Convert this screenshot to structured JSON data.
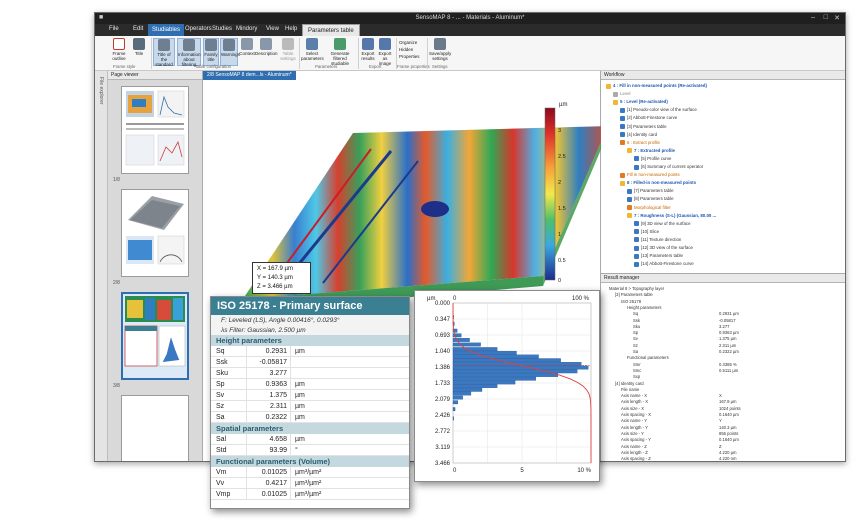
{
  "window": {
    "title": "SensoMAP 8 - ... - Materials - Aluminum*",
    "menus": [
      "File",
      "Edit",
      "Studiables",
      "Operators",
      "Studies",
      "Mindory",
      "View",
      "Help"
    ],
    "context_tab": "Parameters table"
  },
  "ribbon": {
    "buttons": [
      {
        "label": "Frame outline",
        "group": "Frame style"
      },
      {
        "label": "Title",
        "group": "Frame style"
      },
      {
        "label": "Title of the standard",
        "group": "Table configuration"
      },
      {
        "label": "Information about filtering",
        "group": "Table configuration"
      },
      {
        "label": "Family title",
        "group": "Table configuration"
      },
      {
        "label": "Warnings",
        "group": "Table configuration"
      },
      {
        "label": "Context",
        "group": "Table configuration"
      },
      {
        "label": "Description",
        "group": "Table configuration"
      },
      {
        "label": "Table settings",
        "group": "Table configuration"
      },
      {
        "label": "Select parameters",
        "group": "Parameters"
      },
      {
        "label": "Generate filtered studiable",
        "group": "Parameters"
      },
      {
        "label": "Export results",
        "group": "Export"
      },
      {
        "label": "Export as image",
        "group": "Export"
      },
      {
        "label": "Organize",
        "group": "Frame properties"
      },
      {
        "label": "Hidden",
        "group": "Frame properties"
      },
      {
        "label": "Properties",
        "group": "Frame properties"
      },
      {
        "label": "Save/apply settings",
        "group": "Settings"
      }
    ],
    "groups": [
      "Frame style",
      "Table configuration",
      "Parameters",
      "Export",
      "Frame properties",
      "Settings"
    ]
  },
  "left_strip": {
    "label": "File explorer"
  },
  "page_viewer": {
    "title": "Page viewer",
    "pages": [
      "1/8",
      "2/8",
      "3/8",
      "4/8"
    ]
  },
  "document": {
    "tab_label": "2/8 SensoMAP 8 dem...ls - Aluminum*",
    "colorbar": {
      "unit": "µm",
      "ticks": [
        "3",
        "2.5",
        "2",
        "1.5",
        "1",
        "0.5",
        "0"
      ]
    },
    "coordinates": {
      "x": "X = 167.9 µm",
      "y": "Y = 140.3 µm",
      "z": "Z = 3.466 µm"
    }
  },
  "iso_table": {
    "title": "ISO 25178 - Primary surface",
    "filter1": "F: Leveled (LS), Angle 0.00416°, 0.0293°",
    "filter2": "λs Filter: Gaussian, 2.500 µm",
    "sections": [
      {
        "name": "Height parameters",
        "rows": [
          {
            "p": "Sq",
            "v": "0.2931",
            "u": "µm"
          },
          {
            "p": "Ssk",
            "v": "-0.05817",
            "u": ""
          },
          {
            "p": "Sku",
            "v": "3.277",
            "u": ""
          },
          {
            "p": "Sp",
            "v": "0.9363",
            "u": "µm"
          },
          {
            "p": "Sv",
            "v": "1.375",
            "u": "µm"
          },
          {
            "p": "Sz",
            "v": "2.311",
            "u": "µm"
          },
          {
            "p": "Sa",
            "v": "0.2322",
            "u": "µm"
          }
        ]
      },
      {
        "name": "Spatial parameters",
        "rows": [
          {
            "p": "Sal",
            "v": "4.658",
            "u": "µm"
          },
          {
            "p": "Std",
            "v": "93.99",
            "u": "°"
          }
        ]
      },
      {
        "name": "Functional parameters (Volume)",
        "rows": [
          {
            "p": "Vm",
            "v": "0.01025",
            "u": "µm³/µm²"
          },
          {
            "p": "Vv",
            "v": "0.4217",
            "u": "µm³/µm²"
          },
          {
            "p": "Vmp",
            "v": "0.01025",
            "u": "µm³/µm²"
          }
        ]
      }
    ]
  },
  "chart_data": {
    "type": "bar",
    "title": "",
    "xlabel": "%",
    "ylabel": "µm",
    "orientation": "horizontal",
    "ytick_labels": [
      "0.000",
      "0.347",
      "0.693",
      "1.040",
      "1.386",
      "1.733",
      "2.079",
      "2.426",
      "2.772",
      "3.119",
      "3.466"
    ],
    "top_axis_ticks": [
      "0",
      "100 %"
    ],
    "bottom_axis_ticks": [
      "0",
      "5",
      "10 %"
    ],
    "ylim": [
      0,
      3.466
    ],
    "xlim": [
      0,
      10
    ],
    "bin_centers": [
      0.3,
      0.45,
      0.6,
      0.7,
      0.8,
      0.9,
      1.0,
      1.08,
      1.16,
      1.24,
      1.32,
      1.4,
      1.48,
      1.56,
      1.64,
      1.72,
      1.8,
      1.88,
      1.96,
      2.05,
      2.15,
      2.3,
      2.5
    ],
    "values": [
      0.05,
      0.1,
      0.3,
      0.6,
      1.2,
      2.0,
      3.2,
      4.6,
      6.2,
      7.8,
      9.3,
      9.8,
      9.0,
      7.6,
      6.0,
      4.5,
      3.2,
      2.1,
      1.3,
      0.7,
      0.35,
      0.15,
      0.05
    ],
    "series": [
      {
        "name": "Distribution",
        "kind": "bars",
        "color": "#3a78c2"
      },
      {
        "name": "Cumulative",
        "kind": "curve",
        "color": "#e04040"
      }
    ],
    "mean_line": 1.35,
    "grid": true
  },
  "workflow": {
    "title": "Workflow",
    "items": [
      {
        "t": "4 : Fill in non-measured points (Re-activated)",
        "s": "b",
        "indent": 0
      },
      {
        "t": "Level",
        "s": "g",
        "indent": 1
      },
      {
        "t": "5 : Level (Re-activated)",
        "s": "b",
        "indent": 1
      },
      {
        "t": "[1] Pseudo-color view of the surface",
        "s": "",
        "indent": 2
      },
      {
        "t": "[2] Abbott-Firestone curve",
        "s": "",
        "indent": 2
      },
      {
        "t": "[3] Parameters table",
        "s": "",
        "indent": 2
      },
      {
        "t": "[4] Identity card",
        "s": "",
        "indent": 2
      },
      {
        "t": "6 : Extract profile",
        "s": "o",
        "indent": 2
      },
      {
        "t": "7 : Extracted profile",
        "s": "b",
        "indent": 3
      },
      {
        "t": "[5] Profile curve",
        "s": "",
        "indent": 4
      },
      {
        "t": "[6] Summary of current operator",
        "s": "",
        "indent": 4
      },
      {
        "t": "Fill in non-measured points",
        "s": "o",
        "indent": 2
      },
      {
        "t": "8 : Filled-in non-measured points",
        "s": "b",
        "indent": 2
      },
      {
        "t": "[7] Parameters table",
        "s": "",
        "indent": 3
      },
      {
        "t": "[8] Parameters table",
        "s": "",
        "indent": 3
      },
      {
        "t": "Morphological filter",
        "s": "o",
        "indent": 3
      },
      {
        "t": "7 : Roughness (S-L) (Gaussian, 80.00 ...",
        "s": "b",
        "indent": 3
      },
      {
        "t": "[9] 3D view of the surface",
        "s": "",
        "indent": 4
      },
      {
        "t": "[10] Slice",
        "s": "",
        "indent": 4
      },
      {
        "t": "[11] Texture direction",
        "s": "",
        "indent": 4
      },
      {
        "t": "[12] 3D view of the surface",
        "s": "",
        "indent": 4
      },
      {
        "t": "[13] Parameters table",
        "s": "",
        "indent": 4
      },
      {
        "t": "[14] Abbott-Firestone curve",
        "s": "",
        "indent": 4
      }
    ]
  },
  "result_manager": {
    "title": "Result manager",
    "items": [
      {
        "t": "Material 8 > Topography layer",
        "v": "",
        "indent": 0
      },
      {
        "t": "[3] Parameters table",
        "v": "",
        "indent": 1
      },
      {
        "t": "ISO 25178",
        "v": "",
        "indent": 2
      },
      {
        "t": "Height parameters",
        "v": "",
        "indent": 3
      },
      {
        "t": "Sq",
        "v": "0.2931 µm",
        "indent": 4
      },
      {
        "t": "Ssk",
        "v": "-0.05817",
        "indent": 4
      },
      {
        "t": "Sku",
        "v": "3.277",
        "indent": 4
      },
      {
        "t": "Sp",
        "v": "0.9363 µm",
        "indent": 4
      },
      {
        "t": "Sv",
        "v": "1.375 µm",
        "indent": 4
      },
      {
        "t": "Sz",
        "v": "2.311 µm",
        "indent": 4
      },
      {
        "t": "Sa",
        "v": "0.2322 µm",
        "indent": 4
      },
      {
        "t": "Functional parameters",
        "v": "",
        "indent": 3
      },
      {
        "t": "Smr",
        "v": "0.3385 %",
        "indent": 4
      },
      {
        "t": "Smc",
        "v": "0.5111 µm",
        "indent": 4
      },
      {
        "t": "Sxp",
        "v": "",
        "indent": 4
      },
      {
        "t": "[4] Identity card",
        "v": "",
        "indent": 1
      },
      {
        "t": "File name",
        "v": "",
        "indent": 2
      },
      {
        "t": "Axis name - X",
        "v": "X",
        "indent": 2
      },
      {
        "t": "Axis length - X",
        "v": "167.9 µm",
        "indent": 2
      },
      {
        "t": "Axis size - X",
        "v": "1024 points",
        "indent": 2
      },
      {
        "t": "Axis spacing - X",
        "v": "0.1640 µm",
        "indent": 2
      },
      {
        "t": "Axis name - Y",
        "v": "Y",
        "indent": 2
      },
      {
        "t": "Axis length - Y",
        "v": "140.3 µm",
        "indent": 2
      },
      {
        "t": "Axis size - Y",
        "v": "856 points",
        "indent": 2
      },
      {
        "t": "Axis spacing - Y",
        "v": "0.1640 µm",
        "indent": 2
      },
      {
        "t": "Axis name - Z",
        "v": "Z",
        "indent": 2
      },
      {
        "t": "Axis length - Z",
        "v": "4.220 µm",
        "indent": 2
      },
      {
        "t": "Axis spacing - Z",
        "v": "4.220 nm",
        "indent": 2
      }
    ]
  }
}
